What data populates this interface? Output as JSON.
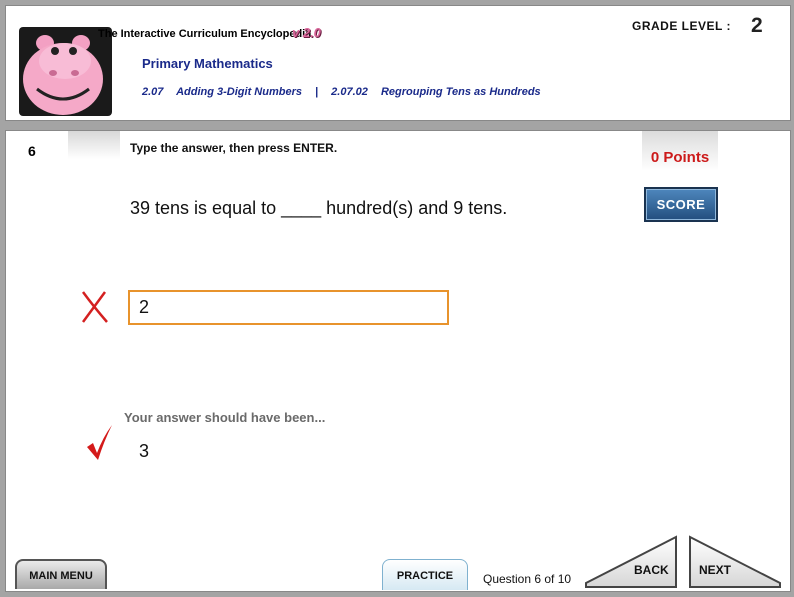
{
  "header": {
    "app_title": "The Interactive Curriculum Encyclopedia",
    "version": "v 2.0",
    "subject": "Primary Mathematics",
    "breadcrumb": {
      "lesson_code": "2.07",
      "lesson_title": "Adding 3-Digit Numbers",
      "separator": "|",
      "topic_code": "2.07.02",
      "topic_title": "Regrouping Tens as Hundreds"
    },
    "grade_label": "GRADE LEVEL :",
    "grade_value": "2",
    "logo_icon": "hippo-mascot-icon"
  },
  "question": {
    "number": "6",
    "instruction": "Type the answer, then press ENTER.",
    "text": "39 tens is equal to ____ hundred(s) and 9 tens.",
    "user_answer": "2",
    "result_icon": "x-mark-icon",
    "should_have_been_label": "Your answer should have been...",
    "correct_answer": "3",
    "correct_icon": "checkmark-icon"
  },
  "score": {
    "points": "0 Points",
    "button_label": "SCORE"
  },
  "footer": {
    "main_menu_label": "MAIN MENU",
    "practice_label": "PRACTICE",
    "progress": "Question 6 of 10",
    "back_label": "BACK",
    "next_label": "NEXT"
  },
  "colors": {
    "accent_blue": "#1a2a8a",
    "points_red": "#cc1a1a",
    "input_border": "#e8932c",
    "score_button": "#2f6aa3",
    "logo_pink": "#f5a3c5"
  }
}
